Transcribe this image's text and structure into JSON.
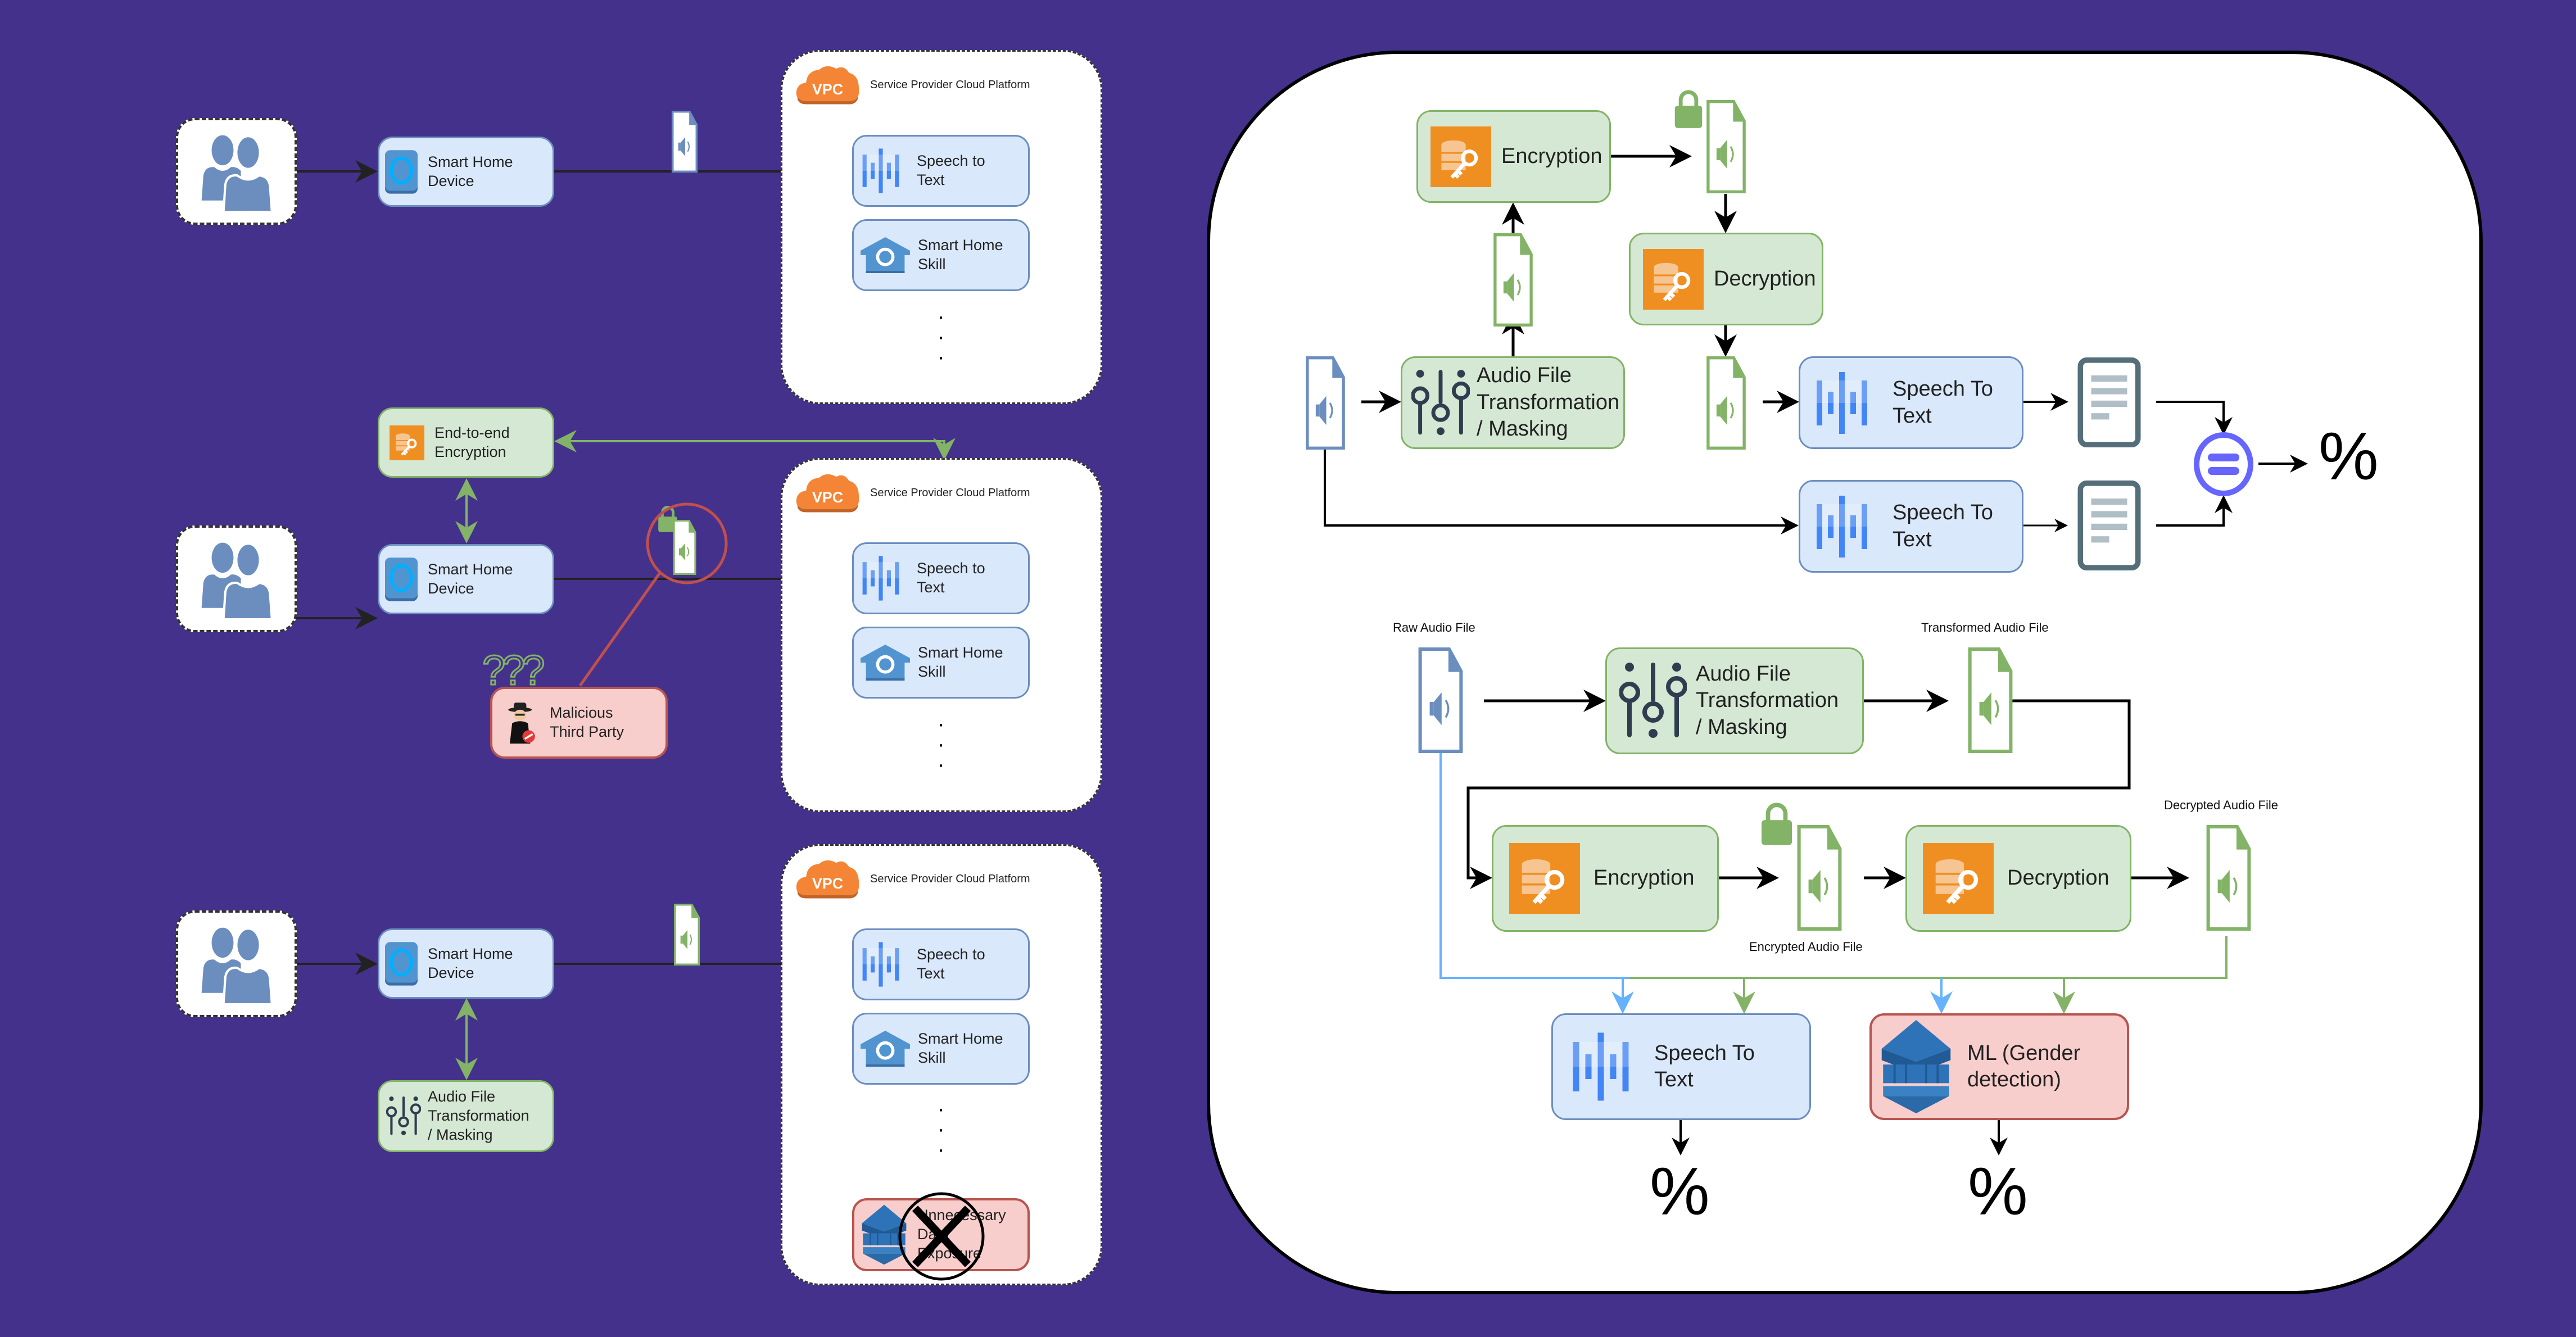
{
  "colors": {
    "background": "#44318b",
    "blue_fill": "#dae8fc",
    "blue_stroke": "#6c8ebf",
    "green_fill": "#d5e8d4",
    "green_stroke": "#82b366",
    "red_fill": "#f8cecc",
    "red_stroke": "#b85450",
    "orange_icon": "#ef8f22",
    "raw_line": "#66b2ff",
    "equality_icon": "#6666ff"
  },
  "left": {
    "scenario1": {
      "device_label": "Smart Home\nDevice",
      "cloud_title": "Service Provider Cloud Platform",
      "vpc_label": "VPC",
      "speech_label": "Speech to\nText",
      "skill_label": "Smart Home\nSkill",
      "ellipsis": "·\n·\n·"
    },
    "scenario2": {
      "encryption_label": "End-to-end\nEncryption",
      "device_label": "Smart Home\nDevice",
      "cloud_title": "Service Provider Cloud Platform",
      "vpc_label": "VPC",
      "speech_label": "Speech to\nText",
      "skill_label": "Smart Home\nSkill",
      "attacker_label": "Malicious\nThird Party",
      "question_marks": "???",
      "ellipsis": "·\n·\n·"
    },
    "scenario3": {
      "device_label": "Smart Home\nDevice",
      "transform_label": "Audio File\nTransformation\n/ Masking",
      "cloud_title": "Service Provider Cloud Platform",
      "vpc_label": "VPC",
      "speech_label": "Speech to\nText",
      "skill_label": "Smart Home\nSkill",
      "exposure_label": "Unnecessary\nData\nExposure",
      "ellipsis": "·\n·\n·"
    }
  },
  "right": {
    "top": {
      "encryption_label": "Encryption",
      "decryption_label": "Decryption",
      "transform_label": "Audio File\nTransformation\n/ Masking",
      "speech1_label": "Speech To\nText",
      "speech2_label": "Speech To\nText",
      "result_symbol": "%"
    },
    "bottom": {
      "raw_caption": "Raw Audio File",
      "transformed_caption": "Transformed Audio File",
      "encrypted_caption": "Encrypted Audio File",
      "decrypted_caption": "Decrypted Audio File",
      "transform_label": "Audio File\nTransformation\n/ Masking",
      "encryption_label": "Encryption",
      "decryption_label": "Decryption",
      "speech_label": "Speech To\nText",
      "ml_label": "ML (Gender\ndetection)",
      "speech_result": "%",
      "ml_result": "%"
    }
  }
}
